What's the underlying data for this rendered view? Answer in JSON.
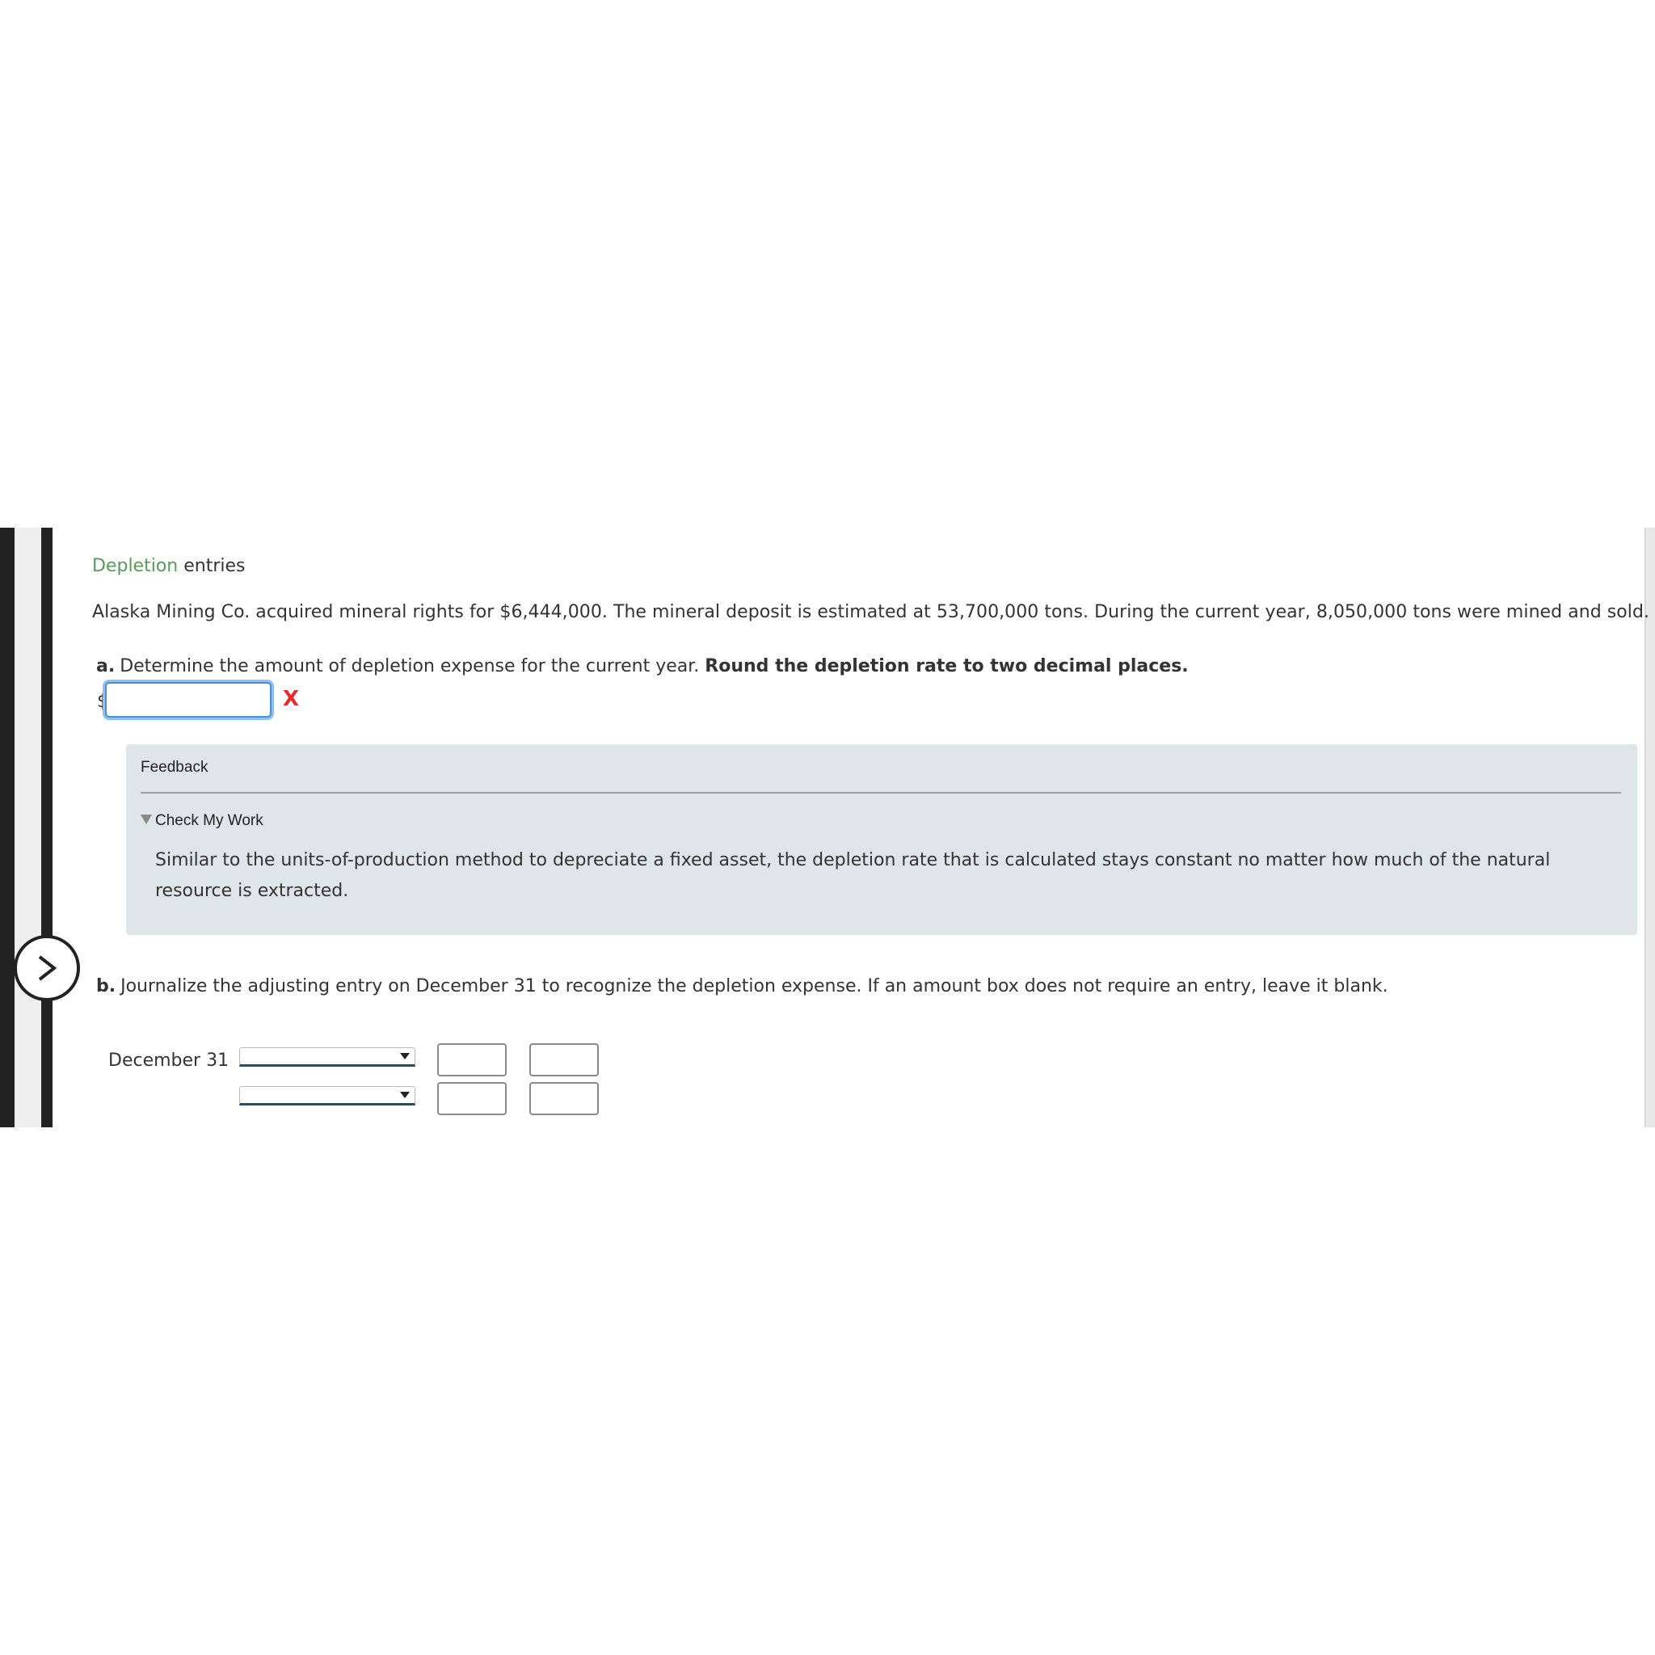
{
  "header": {
    "title_link": "Depletion",
    "title_rest": " entries"
  },
  "problem": {
    "statement": "Alaska Mining Co. acquired mineral rights for $6,444,000. The mineral deposit is estimated at 53,700,000 tons. During the current year, 8,050,000 tons were mined and sold."
  },
  "part_a": {
    "label": "a.",
    "prompt": "Determine the amount of depletion expense for the current year. ",
    "instruction": "Round the depletion rate to two decimal places.",
    "currency_symbol": "$",
    "answer_value": "",
    "status_mark": "X"
  },
  "feedback": {
    "title": "Feedback",
    "toggle_label": "Check My Work",
    "text": "Similar to the units-of-production method to depreciate a fixed asset, the depletion rate that is calculated stays constant no matter how much of the natural resource is extracted."
  },
  "part_b": {
    "label": "b.",
    "prompt": "Journalize the adjusting entry on December 31 to recognize the depletion expense. If an amount box does not require an entry, leave it blank.",
    "journal": {
      "date": "December 31",
      "rows": [
        {
          "account": "",
          "debit": "",
          "credit": ""
        },
        {
          "account": "",
          "debit": "",
          "credit": ""
        }
      ]
    }
  },
  "icons": {
    "nav": "chevron-right-icon",
    "toggle": "triangle-down-icon"
  },
  "colors": {
    "link_green": "#5a9a5a",
    "error_red": "#e03030",
    "feedback_bg": "#dfe6ea",
    "focus_blue": "#4a90d9"
  }
}
